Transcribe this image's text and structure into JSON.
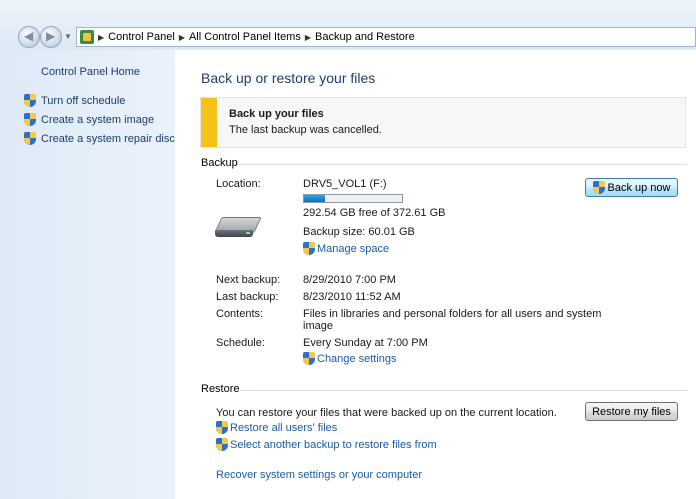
{
  "address_bar": {
    "crumbs": [
      "Control Panel",
      "All Control Panel Items",
      "Backup and Restore"
    ]
  },
  "left_pane": {
    "home_link": "Control Panel Home",
    "tasks": [
      "Turn off schedule",
      "Create a system image",
      "Create a system repair disc"
    ]
  },
  "main": {
    "title": "Back up or restore your files",
    "notice": {
      "title": "Back up your files",
      "text": "The last backup was cancelled."
    },
    "backup": {
      "section_label": "Backup",
      "location_label": "Location:",
      "location_value": "DRV5_VOL1 (F:)",
      "usage_fraction": 0.21,
      "free_text": "292.54 GB free of 372.61 GB",
      "backup_size": "Backup size: 60.01 GB",
      "manage_space": "Manage space",
      "back_up_now": "Back up now",
      "next_backup_label": "Next backup:",
      "next_backup_value": "8/29/2010 7:00 PM",
      "last_backup_label": "Last backup:",
      "last_backup_value": "8/23/2010 11:52 AM",
      "contents_label": "Contents:",
      "contents_value_line1": "Files in libraries and personal folders for all users and system",
      "contents_value_line2": "image",
      "schedule_label": "Schedule:",
      "schedule_value": "Every Sunday at 7:00 PM",
      "change_settings": "Change settings"
    },
    "restore": {
      "section_label": "Restore",
      "description": "You can restore your files that were backed up on the current location.",
      "restore_all_users": "Restore all users' files",
      "select_another": "Select another backup to restore files from",
      "restore_my_files": "Restore my files",
      "recover_system": "Recover system settings or your computer"
    }
  },
  "colors": {
    "link": "#1a5ca8",
    "heading": "#1e3d6e",
    "notice_accent": "#f5c218",
    "left_pane_bg": "#dfeaf7"
  }
}
